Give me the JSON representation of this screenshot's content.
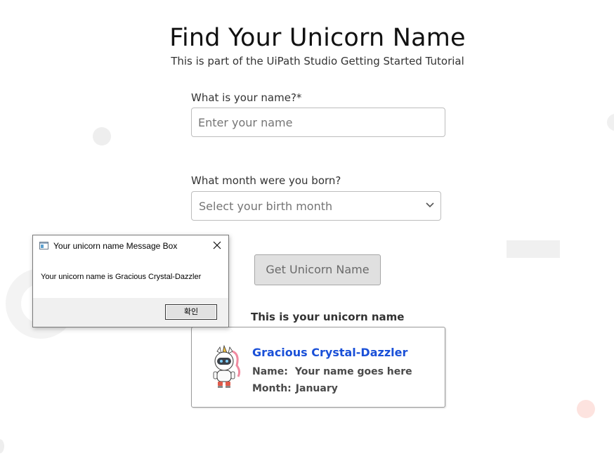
{
  "header": {
    "title": "Find Your Unicorn Name",
    "subtitle": "This is part of the UiPath Studio Getting Started Tutorial"
  },
  "form": {
    "name_label": "What is your name?*",
    "name_placeholder": "Enter your name",
    "name_value": "",
    "month_label": "What month were you born?",
    "month_selected": "Select your birth month",
    "submit_label": "Get Unicorn Name"
  },
  "result": {
    "heading": "This is your unicorn name",
    "unicorn_name": "Gracious Crystal-Dazzler",
    "name_label": "Name:",
    "name_value": "Your name goes here",
    "month_label": "Month:",
    "month_value": "January",
    "unicorn_name_color": "#1a50d8"
  },
  "message_box": {
    "title": "Your unicorn name Message Box",
    "message": "Your unicorn name is Gracious Crystal-Dazzler",
    "ok_label": "확인"
  },
  "icons": {
    "chevron": "chevron-down-icon",
    "close": "close-icon",
    "app": "app-window-icon",
    "unicorn": "unicorn-robot-icon"
  }
}
